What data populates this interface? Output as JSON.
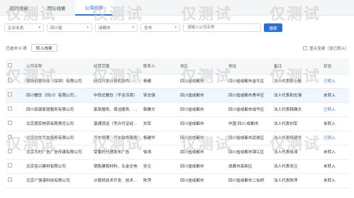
{
  "tabs": [
    {
      "label": "我的线索"
    },
    {
      "label": "团队线索"
    },
    {
      "label": "公海线索"
    }
  ],
  "filters": {
    "industry": "企业业态",
    "province": "四川省",
    "city": "成都市",
    "district": "全市",
    "search_placeholder": "请输入公司名称",
    "search_label": "搜索"
  },
  "toolbar": {
    "selected_count": "已选中 0 项",
    "import_label": "转入线索",
    "show_all_label": "显示全部（含已转入）"
  },
  "table": {
    "headers": [
      "公司名称",
      "经营范围",
      "联系人",
      "地区",
      "地址",
      "备注",
      "状态"
    ],
    "tag_label": "企业名片",
    "rows": [
      {
        "company": "独特创意科技（深圳）有限公司",
        "scope": "研究开发计算机软件、硬件",
        "contact": "杨建",
        "region": "四川省成都市",
        "address": "四川省成都市金牛区",
        "note": "法人代表彭小磊",
        "status": "已转入",
        "claimed": true
      },
      {
        "company": "四川餐饮（四川）有限公司",
        "scope": "中西式餐饮（不含凉菜）",
        "contact": "宋志强",
        "region": "四川省成都市",
        "address": "四川省成都市青羊区",
        "note": "法人代表和志强",
        "status": "未转入",
        "claimed": false,
        "tag": true
      },
      {
        "company": "四川佰源家居服务有限公司",
        "scope": "家政服务、保洁服务、居家",
        "contact": "韩雅文",
        "region": "四川省成都市",
        "address": "四川省成都市成华区",
        "note": "法人代表韩雅文",
        "status": "已转入",
        "claimed": true
      },
      {
        "company": "北京度宏物资有限责任公司",
        "scope": "普通货运（凭许可证经营）",
        "contact": "刘军",
        "region": "四川省成都市",
        "address": "中国 四川 成都市",
        "note": "法人代表刘军",
        "status": "未转入",
        "claimed": false
      },
      {
        "company": "北京优优汽车服务有限公司",
        "scope": "汽车修理、汽车装饰服务",
        "contact": "杨建华",
        "region": "四川省成都市",
        "address": "四川省成都市武侯区",
        "note": "法人代表杨建华",
        "status": "已转入",
        "claimed": true
      },
      {
        "company": "北京大时广告广告传媒有限公司",
        "scope": "受委托代理发布广告",
        "contact": "徐涛",
        "region": "四川省成都市",
        "address": "四川省成都市锦江区",
        "note": "法人代表徐涛",
        "status": "未转入",
        "claimed": false
      },
      {
        "company": "北京佳兴建材有限公司",
        "scope": "销售建筑材料、五金交电",
        "contact": "宋立",
        "region": "四川省成都市",
        "address": "成都市高新区",
        "note": "法人代表宋立",
        "status": "未转入",
        "claimed": false
      },
      {
        "company": "北京广强港科技有限公司",
        "scope": "计算机技术开发、技术服务",
        "contact": "陈萍",
        "region": "四川省成都市",
        "address": "四川省成都市二仙桥",
        "note": "法人代表陈萍",
        "status": "未转入",
        "claimed": false
      }
    ]
  },
  "watermark": {
    "text": "仅测试"
  }
}
